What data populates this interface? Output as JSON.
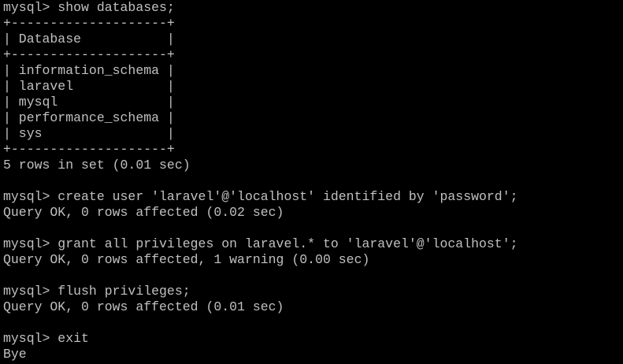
{
  "terminal": {
    "lines": [
      "mysql> show databases;",
      "+--------------------+",
      "| Database           |",
      "+--------------------+",
      "| information_schema |",
      "| laravel            |",
      "| mysql              |",
      "| performance_schema |",
      "| sys                |",
      "+--------------------+",
      "5 rows in set (0.01 sec)",
      "",
      "mysql> create user 'laravel'@'localhost' identified by 'password';",
      "Query OK, 0 rows affected (0.02 sec)",
      "",
      "mysql> grant all privileges on laravel.* to 'laravel'@'localhost';",
      "Query OK, 0 rows affected, 1 warning (0.00 sec)",
      "",
      "mysql> flush privileges;",
      "Query OK, 0 rows affected (0.01 sec)",
      "",
      "mysql> exit",
      "Bye"
    ]
  }
}
